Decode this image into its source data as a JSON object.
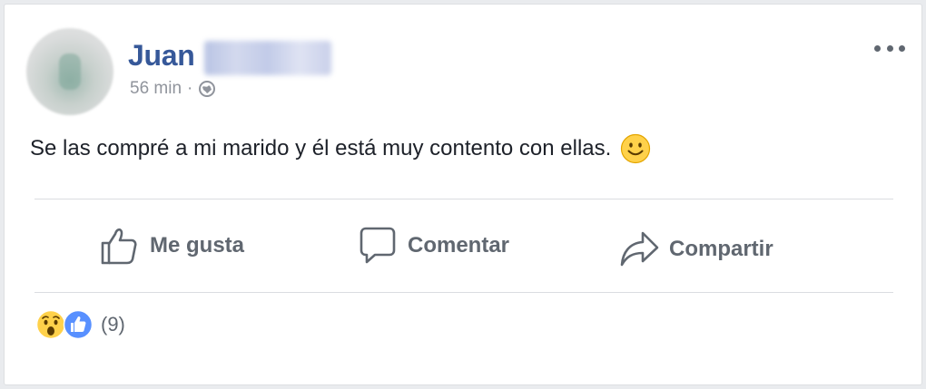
{
  "post": {
    "author_name": "Juan",
    "timestamp": "56 min",
    "separator": "·",
    "privacy_icon": "globe-icon",
    "text": "Se las compré a mi marido y él está muy contento con ellas.",
    "emoji": "smile-icon",
    "menu_icon": "more-options-icon"
  },
  "actions": {
    "like_label": "Me gusta",
    "comment_label": "Comentar",
    "share_label": "Compartir"
  },
  "reactions": {
    "icons": [
      "wow-icon",
      "like-icon"
    ],
    "count": "(9)"
  },
  "colors": {
    "author_name": "#365899",
    "meta_text": "#90949c",
    "body_text": "#1d2129",
    "action_text": "#606770",
    "like_blue": "#5890ff",
    "emoji_yellow": "#ffd14a"
  }
}
